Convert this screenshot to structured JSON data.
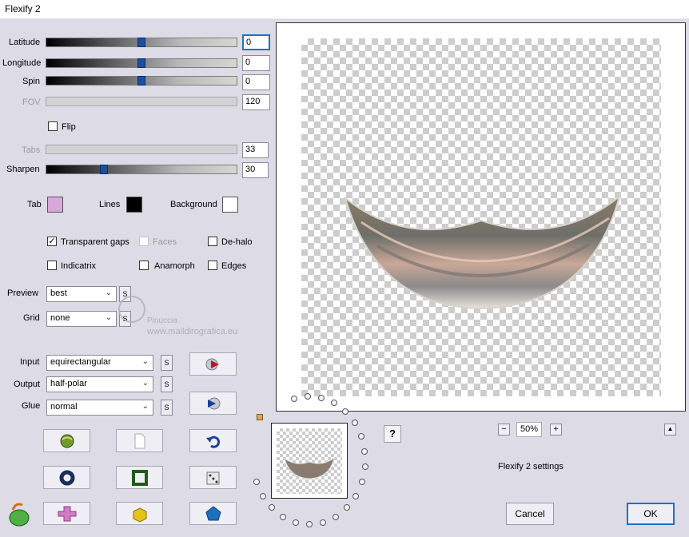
{
  "window": {
    "title": "Flexify 2"
  },
  "sliders": [
    {
      "label": "Latitude",
      "value": "0",
      "level": 0.5,
      "enabled": true
    },
    {
      "label": "Longitude",
      "value": "0",
      "level": 0.5,
      "enabled": true
    },
    {
      "label": "Spin",
      "value": "0",
      "level": 0.5,
      "enabled": true
    },
    {
      "label": "FOV",
      "value": "120",
      "enabled": false
    },
    {
      "label": "Tabs",
      "value": "33",
      "enabled": false
    },
    {
      "label": "Sharpen",
      "value": "30",
      "level": 0.3,
      "enabled": true
    }
  ],
  "flip": {
    "label": "Flip",
    "checked": false
  },
  "colors": {
    "tab": {
      "label": "Tab",
      "color": "#d8a8dc"
    },
    "lines": {
      "label": "Lines",
      "color": "#000000"
    },
    "background": {
      "label": "Background",
      "color": "#ffffff"
    }
  },
  "options": {
    "transparent_gaps": {
      "label": "Transparent gaps",
      "checked": true
    },
    "faces": {
      "label": "Faces",
      "checked": false,
      "enabled": false
    },
    "de_halo": {
      "label": "De-halo",
      "checked": false
    },
    "indicatrix": {
      "label": "Indicatrix",
      "checked": false
    },
    "anamorph": {
      "label": "Anamorph",
      "checked": false
    },
    "edges": {
      "label": "Edges",
      "checked": false
    }
  },
  "selects": {
    "preview": {
      "label": "Preview",
      "value": "best"
    },
    "grid": {
      "label": "Grid",
      "value": "none"
    },
    "input": {
      "label": "Input",
      "value": "equirectangular"
    },
    "output": {
      "label": "Output",
      "value": "half-polar"
    },
    "glue": {
      "label": "Glue",
      "value": "normal"
    }
  },
  "s_label": "S",
  "watermark": {
    "line1": "Pinuccia",
    "line2": "www.maildirografica.eu"
  },
  "zoom": {
    "minus": "−",
    "value": "50%",
    "plus": "+"
  },
  "help": "?",
  "collapse": "▲",
  "settings_label": "Flexify 2 settings",
  "buttons": {
    "cancel": "Cancel",
    "ok": "OK"
  }
}
